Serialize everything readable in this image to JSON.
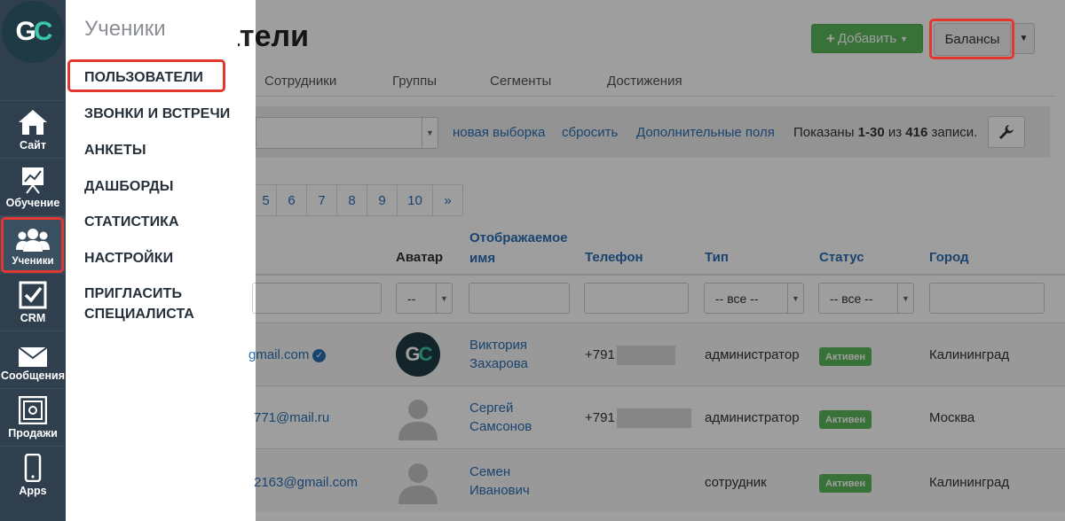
{
  "sidebar": {
    "logo": "GC",
    "items": [
      {
        "label": "Сайт",
        "icon": "home-icon"
      },
      {
        "label": "Обучение",
        "icon": "chart-icon"
      },
      {
        "label": "Ученики",
        "icon": "users-icon"
      },
      {
        "label": "CRM",
        "icon": "checkbox-icon"
      },
      {
        "label": "Сообщения",
        "icon": "envelope-icon"
      },
      {
        "label": "Продажи",
        "icon": "safe-icon"
      },
      {
        "label": "Apps",
        "icon": "phone-icon"
      }
    ]
  },
  "submenu": {
    "title": "Ученики",
    "items": [
      "ПОЛЬЗОВАТЕЛИ",
      "ЗВОНКИ И ВСТРЕЧИ",
      "АНКЕТЫ",
      "ДАШБОРДЫ",
      "СТАТИСТИКА",
      "НАСТРОЙКИ",
      "ПРИГЛАСИТЬ СПЕЦИАЛИСТА"
    ]
  },
  "header": {
    "title": "Пользователи",
    "add_label": "Добавить",
    "balances_label": "Балансы"
  },
  "tabs": [
    "Сотрудники",
    "Группы",
    "Сегменты",
    "Достижения"
  ],
  "filters": {
    "new_selection": "новая выборка",
    "reset": "сбросить",
    "extra_fields": "Дополнительные поля",
    "shown_prefix": "Показаны",
    "shown_range": "1-30",
    "shown_mid": "из",
    "shown_total": "416",
    "shown_suffix": "записи."
  },
  "pagination": [
    "5",
    "6",
    "7",
    "8",
    "9",
    "10",
    "»"
  ],
  "table": {
    "headers": {
      "avatar": "Аватар",
      "display_name_1": "Отображаемое",
      "display_name_2": "имя",
      "phone": "Телефон",
      "type": "Тип",
      "status": "Статус",
      "city": "Город"
    },
    "filter_avatar": "--",
    "filter_type": "-- все --",
    "filter_status": "-- все --",
    "rows": [
      {
        "email": "gmail.com",
        "name_1": "Виктория",
        "name_2": "Захарова",
        "phone": "+791",
        "type": "администратор",
        "status": "Активен",
        "city": "Калининград"
      },
      {
        "email": "771@mail.ru",
        "name_1": "Сергей",
        "name_2": "Самсонов",
        "phone": "+791",
        "type": "администратор",
        "status": "Активен",
        "city": "Москва"
      },
      {
        "email": "2163@gmail.com",
        "name_1": "Семен",
        "name_2": "Иванович",
        "phone": "",
        "type": "сотрудник",
        "status": "Активен",
        "city": "Калининград"
      }
    ]
  },
  "colors": {
    "sidebar_bg": "#2f3f4d",
    "highlight_red": "#e2372f",
    "success_green": "#5cb85c",
    "link_blue": "#2a6fb5"
  }
}
